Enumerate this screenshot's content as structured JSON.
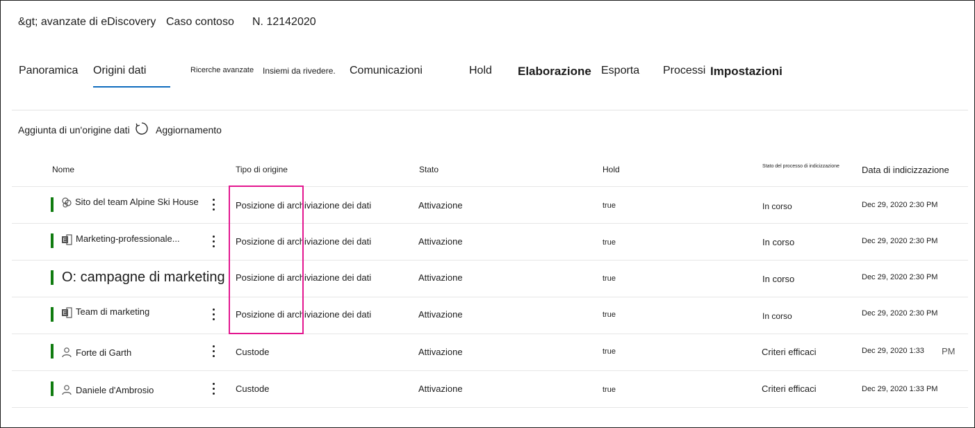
{
  "header": {
    "breadcrumb_root": "&gt; avanzate di eDiscovery",
    "case_name": "Caso contoso",
    "case_number": "N. 12142020"
  },
  "tabs": [
    {
      "label": "Panoramica"
    },
    {
      "label": "Origini dati",
      "selected": true
    },
    {
      "label": "Ricerche avanzate"
    },
    {
      "label": "Insiemi da rivedere."
    },
    {
      "label": "Comunicazioni"
    },
    {
      "label": "Hold"
    },
    {
      "label": "Elaborazione"
    },
    {
      "label": "Esporta"
    },
    {
      "label": "Processi"
    },
    {
      "label": "Impostazioni"
    }
  ],
  "toolbar": {
    "add_source": "Aggiunta di un'origine dati",
    "refresh": "Aggiornamento"
  },
  "columns": {
    "name": "Nome",
    "source_type": "Tipo di origine",
    "status": "Stato",
    "hold": "Hold",
    "index_status": "Stato del processo di indicizzazione",
    "index_date": "Data di indicizzazione"
  },
  "rows": [
    {
      "name": "Sito del team Alpine Ski House",
      "icon": "sharepoint-icon",
      "source_type": "Posizione di archiviazione dei dati",
      "status": "Attivazione",
      "hold": "true",
      "index_status": "In corso",
      "index_date": "Dec 29, 2020 2:30 PM"
    },
    {
      "name": "Marketing-professionale...",
      "icon": "exchange-icon",
      "source_type": "Posizione di archiviazione dei dati",
      "status": "Attivazione",
      "hold": "true",
      "index_status": "In corso",
      "index_date": "Dec 29, 2020 2:30 PM"
    },
    {
      "name": "O: campagne di marketing",
      "icon": "",
      "source_type": "Posizione di archiviazione dei dati",
      "status": "Attivazione",
      "hold": "true",
      "index_status": "In corso",
      "index_date": "Dec 29, 2020 2:30 PM"
    },
    {
      "name": "Team di marketing",
      "icon": "exchange-icon",
      "source_type": "Posizione di archiviazione dei dati",
      "status": "Attivazione",
      "hold": "true",
      "index_status": "In corso",
      "index_date": "Dec 29, 2020 2:30 PM"
    },
    {
      "name": "Forte di Garth",
      "icon": "person-icon",
      "source_type": "Custode",
      "status": "Attivazione",
      "hold": "true",
      "index_status": "Criteri efficaci",
      "index_date": "Dec 29, 2020 1:33",
      "index_date_suffix": "PM"
    },
    {
      "name": "Daniele d'Ambrosio",
      "icon": "person-icon",
      "source_type": "Custode",
      "status": "Attivazione",
      "hold": "true",
      "index_status": "Criteri efficaci",
      "index_date": "Dec 29, 2020 1:33 PM"
    }
  ],
  "colors": {
    "status_active": "#107c10",
    "tab_selected": "#0f6cbd",
    "highlight": "#e3168f"
  }
}
